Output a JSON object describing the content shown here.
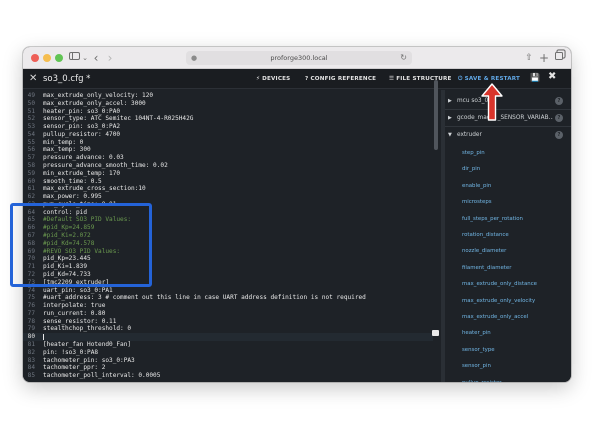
{
  "browser": {
    "url": "proforge300.local"
  },
  "toolbar": {
    "file_title": "so3_0.cfg *",
    "devices_label": "DEVICES",
    "config_reference_label": "CONFIG REFERENCE",
    "file_structure_label": "FILE STRUCTURE",
    "save_restart_label": "SAVE & RESTART",
    "accent_color": "#61a9e8"
  },
  "editor": {
    "lines": [
      {
        "n": "49",
        "text": "max_extrude_only_velocity: 120"
      },
      {
        "n": "50",
        "text": "max_extrude_only_accel: 3000"
      },
      {
        "n": "51",
        "text": "heater_pin: so3_0:PA0"
      },
      {
        "n": "52",
        "text": "sensor_type: ATC Semitec 104NT-4-R025H42G"
      },
      {
        "n": "53",
        "text": "sensor_pin: so3_0:PA2"
      },
      {
        "n": "54",
        "text": "pullup_resistor: 4700"
      },
      {
        "n": "55",
        "text": "min_temp: 0"
      },
      {
        "n": "56",
        "text": "max_temp: 300"
      },
      {
        "n": "57",
        "text": "pressure_advance: 0.03"
      },
      {
        "n": "58",
        "text": "pressure_advance_smooth_time: 0.02"
      },
      {
        "n": "59",
        "text": "min_extrude_temp: 170"
      },
      {
        "n": "60",
        "text": "smooth_time: 0.5"
      },
      {
        "n": "61",
        "text": "max_extrude_cross_section:10"
      },
      {
        "n": "62",
        "text": "max_power: 0.995"
      },
      {
        "n": "63",
        "text": "pwm_cycle_time: 0.01"
      },
      {
        "n": "64",
        "text": "control: pid"
      },
      {
        "n": "65",
        "text": "#Default SO3 PID Values:",
        "comment": true
      },
      {
        "n": "66",
        "text": "#pid_Kp=24.859",
        "comment": true
      },
      {
        "n": "67",
        "text": "#pid_Ki=2.072",
        "comment": true
      },
      {
        "n": "68",
        "text": "#pid_Kd=74.578",
        "comment": true
      },
      {
        "n": "69",
        "text": "#REVO SO3 PID Values:",
        "comment": true
      },
      {
        "n": "70",
        "text": "pid_Kp=23.445"
      },
      {
        "n": "71",
        "text": "pid_Ki=1.839"
      },
      {
        "n": "72",
        "text": "pid_Kd=74.733"
      },
      {
        "n": "73",
        "text": "[tmc2209 extruder]"
      },
      {
        "n": "74",
        "text": "uart_pin: so3_0:PA1"
      },
      {
        "n": "75",
        "text": "#uart_address: 3 # comment out this line in case UART address definition is not required"
      },
      {
        "n": "76",
        "text": "interpolate: true"
      },
      {
        "n": "77",
        "text": "run_current: 0.80"
      },
      {
        "n": "78",
        "text": "sense_resistor: 0.11"
      },
      {
        "n": "79",
        "text": "stealthchop_threshold: 0"
      },
      {
        "n": "80",
        "text": "",
        "current": true
      },
      {
        "n": "81",
        "text": "[heater_fan Hotend0_Fan]"
      },
      {
        "n": "82",
        "text": "pin: !so3_0:PA8"
      },
      {
        "n": "83",
        "text": "tachometer_pin: so3_0:PA3"
      },
      {
        "n": "84",
        "text": "tachometer_ppr: 2"
      },
      {
        "n": "85",
        "text": "tachometer_poll_interval: 0.0005"
      }
    ]
  },
  "sidebar": {
    "top_items": [
      {
        "name": "mcu so3_0",
        "expanded": false
      },
      {
        "name": "gcode_macro _SENSOR_VARIAB...",
        "expanded": false
      },
      {
        "name": "extruder",
        "expanded": true
      }
    ],
    "sub_items": [
      "step_pin",
      "dir_pin",
      "enable_pin",
      "microsteps",
      "full_steps_per_rotation",
      "rotation_distance",
      "nozzle_diameter",
      "filament_diameter",
      "max_extrude_only_distance",
      "max_extrude_only_velocity",
      "max_extrude_only_accel",
      "heater_pin",
      "sensor_type",
      "sensor_pin",
      "pullup_resistor"
    ],
    "link_color": "#72b7e6"
  },
  "annotations": {
    "highlight_color": "#2463d8",
    "arrow_color": "#d9342b"
  }
}
